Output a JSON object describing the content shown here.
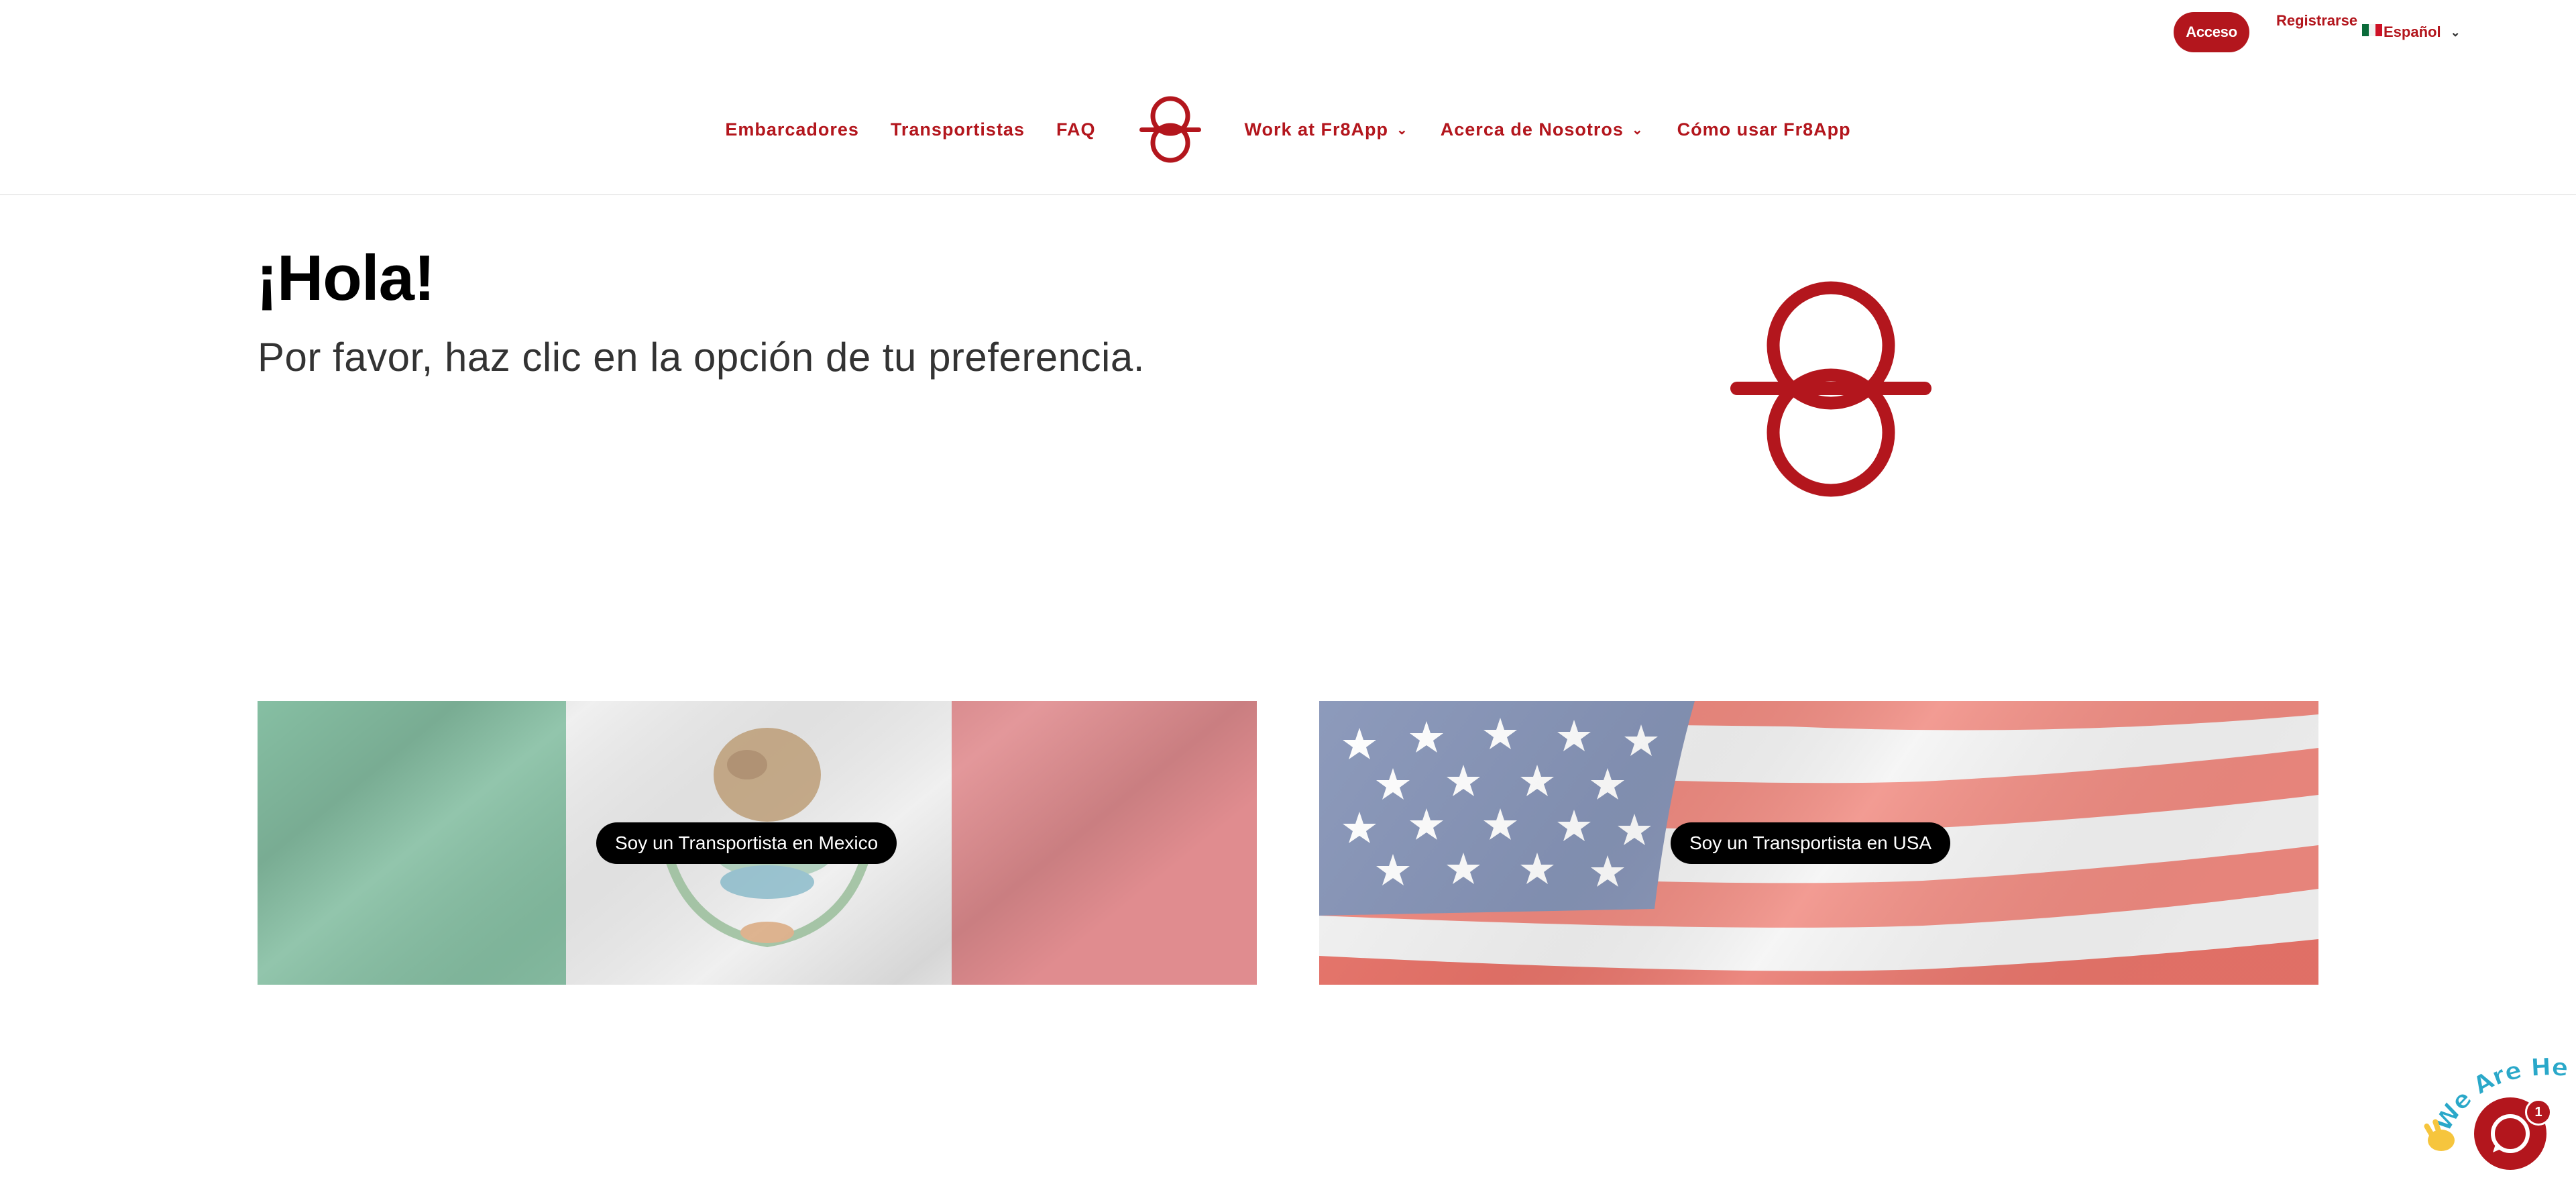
{
  "topbar": {
    "login_label": "Acceso",
    "register_label": "Registrarse",
    "language_label": "Español"
  },
  "nav": {
    "items": [
      {
        "label": "Embarcadores"
      },
      {
        "label": "Transportistas"
      },
      {
        "label": "FAQ"
      },
      {
        "label": "Work at Fr8App",
        "dropdown": true
      },
      {
        "label": "Acerca de Nosotros",
        "dropdown": true
      },
      {
        "label": "Cómo usar Fr8App"
      }
    ]
  },
  "hero": {
    "title": "¡Hola!",
    "subtitle": "Por favor, haz clic en la opción de tu preferencia."
  },
  "cards": {
    "mexico_button": "Soy un Transportista en Mexico",
    "usa_button": "Soy un Transportista en USA"
  },
  "chat": {
    "tag_text": "We Are Here!",
    "badge_count": "1"
  },
  "colors": {
    "brand_red": "#b3161d",
    "black": "#000000",
    "white": "#ffffff"
  },
  "icons": [
    "fr8app-logo-icon",
    "chevron-down-icon",
    "mexico-flag-icon",
    "chat-icon",
    "waving-hand-icon"
  ]
}
